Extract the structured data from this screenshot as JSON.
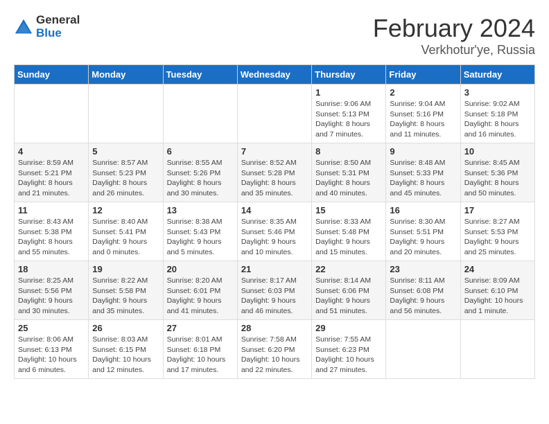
{
  "header": {
    "logo_general": "General",
    "logo_blue": "Blue",
    "title": "February 2024",
    "subtitle": "Verkhotur'ye, Russia"
  },
  "days_of_week": [
    "Sunday",
    "Monday",
    "Tuesday",
    "Wednesday",
    "Thursday",
    "Friday",
    "Saturday"
  ],
  "weeks": [
    [
      {
        "day": "",
        "detail": ""
      },
      {
        "day": "",
        "detail": ""
      },
      {
        "day": "",
        "detail": ""
      },
      {
        "day": "",
        "detail": ""
      },
      {
        "day": "1",
        "detail": "Sunrise: 9:06 AM\nSunset: 5:13 PM\nDaylight: 8 hours\nand 7 minutes."
      },
      {
        "day": "2",
        "detail": "Sunrise: 9:04 AM\nSunset: 5:16 PM\nDaylight: 8 hours\nand 11 minutes."
      },
      {
        "day": "3",
        "detail": "Sunrise: 9:02 AM\nSunset: 5:18 PM\nDaylight: 8 hours\nand 16 minutes."
      }
    ],
    [
      {
        "day": "4",
        "detail": "Sunrise: 8:59 AM\nSunset: 5:21 PM\nDaylight: 8 hours\nand 21 minutes."
      },
      {
        "day": "5",
        "detail": "Sunrise: 8:57 AM\nSunset: 5:23 PM\nDaylight: 8 hours\nand 26 minutes."
      },
      {
        "day": "6",
        "detail": "Sunrise: 8:55 AM\nSunset: 5:26 PM\nDaylight: 8 hours\nand 30 minutes."
      },
      {
        "day": "7",
        "detail": "Sunrise: 8:52 AM\nSunset: 5:28 PM\nDaylight: 8 hours\nand 35 minutes."
      },
      {
        "day": "8",
        "detail": "Sunrise: 8:50 AM\nSunset: 5:31 PM\nDaylight: 8 hours\nand 40 minutes."
      },
      {
        "day": "9",
        "detail": "Sunrise: 8:48 AM\nSunset: 5:33 PM\nDaylight: 8 hours\nand 45 minutes."
      },
      {
        "day": "10",
        "detail": "Sunrise: 8:45 AM\nSunset: 5:36 PM\nDaylight: 8 hours\nand 50 minutes."
      }
    ],
    [
      {
        "day": "11",
        "detail": "Sunrise: 8:43 AM\nSunset: 5:38 PM\nDaylight: 8 hours\nand 55 minutes."
      },
      {
        "day": "12",
        "detail": "Sunrise: 8:40 AM\nSunset: 5:41 PM\nDaylight: 9 hours\nand 0 minutes."
      },
      {
        "day": "13",
        "detail": "Sunrise: 8:38 AM\nSunset: 5:43 PM\nDaylight: 9 hours\nand 5 minutes."
      },
      {
        "day": "14",
        "detail": "Sunrise: 8:35 AM\nSunset: 5:46 PM\nDaylight: 9 hours\nand 10 minutes."
      },
      {
        "day": "15",
        "detail": "Sunrise: 8:33 AM\nSunset: 5:48 PM\nDaylight: 9 hours\nand 15 minutes."
      },
      {
        "day": "16",
        "detail": "Sunrise: 8:30 AM\nSunset: 5:51 PM\nDaylight: 9 hours\nand 20 minutes."
      },
      {
        "day": "17",
        "detail": "Sunrise: 8:27 AM\nSunset: 5:53 PM\nDaylight: 9 hours\nand 25 minutes."
      }
    ],
    [
      {
        "day": "18",
        "detail": "Sunrise: 8:25 AM\nSunset: 5:56 PM\nDaylight: 9 hours\nand 30 minutes."
      },
      {
        "day": "19",
        "detail": "Sunrise: 8:22 AM\nSunset: 5:58 PM\nDaylight: 9 hours\nand 35 minutes."
      },
      {
        "day": "20",
        "detail": "Sunrise: 8:20 AM\nSunset: 6:01 PM\nDaylight: 9 hours\nand 41 minutes."
      },
      {
        "day": "21",
        "detail": "Sunrise: 8:17 AM\nSunset: 6:03 PM\nDaylight: 9 hours\nand 46 minutes."
      },
      {
        "day": "22",
        "detail": "Sunrise: 8:14 AM\nSunset: 6:06 PM\nDaylight: 9 hours\nand 51 minutes."
      },
      {
        "day": "23",
        "detail": "Sunrise: 8:11 AM\nSunset: 6:08 PM\nDaylight: 9 hours\nand 56 minutes."
      },
      {
        "day": "24",
        "detail": "Sunrise: 8:09 AM\nSunset: 6:10 PM\nDaylight: 10 hours\nand 1 minute."
      }
    ],
    [
      {
        "day": "25",
        "detail": "Sunrise: 8:06 AM\nSunset: 6:13 PM\nDaylight: 10 hours\nand 6 minutes."
      },
      {
        "day": "26",
        "detail": "Sunrise: 8:03 AM\nSunset: 6:15 PM\nDaylight: 10 hours\nand 12 minutes."
      },
      {
        "day": "27",
        "detail": "Sunrise: 8:01 AM\nSunset: 6:18 PM\nDaylight: 10 hours\nand 17 minutes."
      },
      {
        "day": "28",
        "detail": "Sunrise: 7:58 AM\nSunset: 6:20 PM\nDaylight: 10 hours\nand 22 minutes."
      },
      {
        "day": "29",
        "detail": "Sunrise: 7:55 AM\nSunset: 6:23 PM\nDaylight: 10 hours\nand 27 minutes."
      },
      {
        "day": "",
        "detail": ""
      },
      {
        "day": "",
        "detail": ""
      }
    ]
  ]
}
